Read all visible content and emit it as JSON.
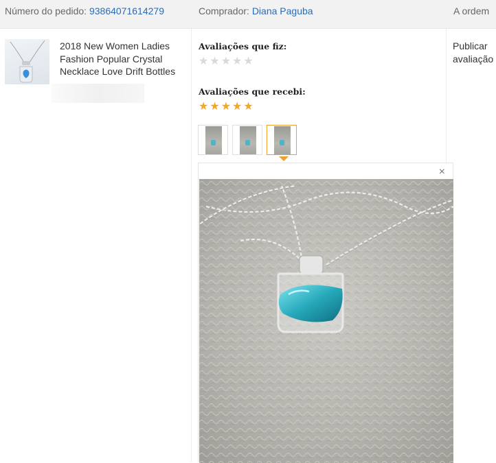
{
  "header": {
    "order_label": "Número do pedido:",
    "order_number": "93864071614279",
    "buyer_label": "Comprador:",
    "buyer_name": "Diana Paguba",
    "right_label": "A ordem"
  },
  "product": {
    "title": "2018 New Women Ladies Fashion Popular Crystal Necklace Love Drift Bottles",
    "thumbnail_icon": "necklace-photo"
  },
  "reviews": {
    "given_label": "Avaliações que fiz:",
    "given_stars": 0,
    "received_label": "Avaliações que recebi:",
    "received_stars": 5,
    "max_stars": 5,
    "photo_count": 3,
    "selected_photo_index": 2
  },
  "actions": {
    "publish_line1": "Publicar",
    "publish_line2": "avaliação"
  },
  "viewer": {
    "close_symbol": "×"
  },
  "colors": {
    "link": "#2b6bb5",
    "star_on": "#f5a623",
    "star_off": "#d9d9d9",
    "active_border": "#f0a030",
    "gem": "#3ab8c8"
  }
}
